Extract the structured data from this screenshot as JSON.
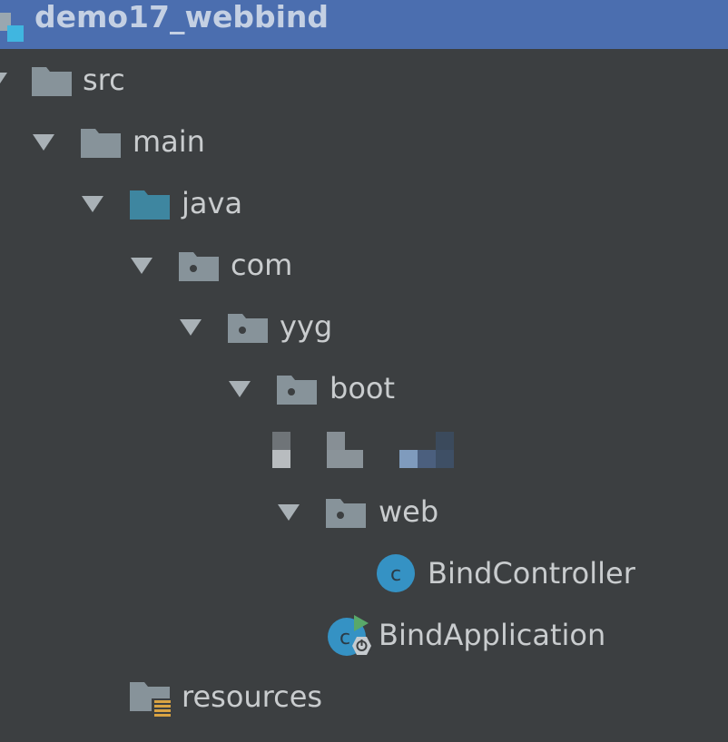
{
  "project": {
    "title": "demo17_webbind",
    "icon": "project-module-icon"
  },
  "tree": {
    "nodes": [
      {
        "label": "src",
        "icon": "folder-icon",
        "expanded": true
      },
      {
        "label": "main",
        "icon": "folder-icon",
        "expanded": true
      },
      {
        "label": "java",
        "icon": "source-root-folder-icon",
        "expanded": true
      },
      {
        "label": "com",
        "icon": "package-icon",
        "expanded": true
      },
      {
        "label": "yyg",
        "icon": "package-icon",
        "expanded": true
      },
      {
        "label": "boot",
        "icon": "package-icon",
        "expanded": true
      },
      {
        "label": "",
        "icon": "obscured-row-icon",
        "expanded": false
      },
      {
        "label": "web",
        "icon": "package-icon",
        "expanded": true
      },
      {
        "label": "BindController",
        "icon": "java-class-icon"
      },
      {
        "label": "BindApplication",
        "icon": "spring-boot-application-icon"
      },
      {
        "label": "resources",
        "icon": "resources-folder-icon"
      }
    ]
  },
  "colors": {
    "background": "#3c3f41",
    "header": "#4b6eaf",
    "folder": "#87939a",
    "source_root": "#3e86a0",
    "class_circle": "#3592c4",
    "run_green": "#59a869",
    "resources_lines": "#d9a343"
  }
}
